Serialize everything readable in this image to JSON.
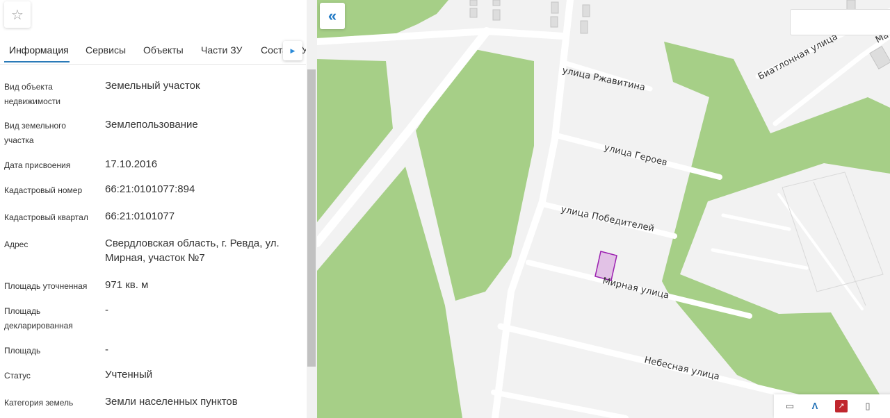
{
  "panel": {
    "favorite_icon": "star-icon",
    "tabs": [
      {
        "label": "Информация"
      },
      {
        "label": "Сервисы"
      },
      {
        "label": "Объекты"
      },
      {
        "label": "Части ЗУ"
      },
      {
        "label": "Состав ЗУ"
      }
    ],
    "next_icon": "triangle-right-icon",
    "rows": [
      {
        "label": "Вид объекта недвижимости",
        "value": "Земельный участок"
      },
      {
        "label": "Вид земельного участка",
        "value": "Землепользование"
      },
      {
        "label": "Дата присвоения",
        "value": "17.10.2016"
      },
      {
        "label": "Кадастровый номер",
        "value": "66:21:0101077:894"
      },
      {
        "label": "Кадастровый квартал",
        "value": "66:21:0101077"
      },
      {
        "label": "Адрес",
        "value": "Свердловская область, г. Ревда, ул. Мирная, участок №7"
      },
      {
        "label": "Площадь уточненная",
        "value": "971 кв. м"
      },
      {
        "label": "Площадь декларированная",
        "value": "-"
      },
      {
        "label": "Площадь",
        "value": "-"
      },
      {
        "label": "Статус",
        "value": "Учтенный"
      },
      {
        "label": "Категория земель",
        "value": "Земли населенных пунктов"
      }
    ]
  },
  "map": {
    "collapse_icon": "double-chevron-left-icon",
    "streets": [
      "улица Ржавитина",
      "улица Героев",
      "улица Победителей",
      "Мирная улица",
      "Небесная улица",
      "Биатлонная улица",
      "Ма"
    ],
    "colors": {
      "green": "#a6cf87",
      "road": "#ffffff",
      "background": "#f2f2f2",
      "parcel_fill": "#e2c2e6",
      "parcel_stroke": "#9b1fb0",
      "accent": "#2a7ab8"
    },
    "toolbar_icons": [
      "print-icon",
      "measure-icon",
      "pdf-icon",
      "document-icon"
    ]
  }
}
